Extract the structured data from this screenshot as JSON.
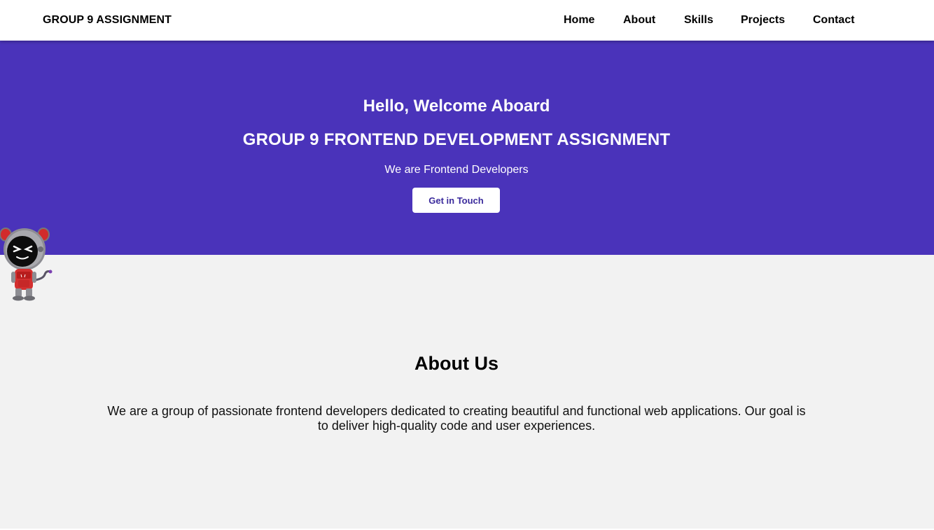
{
  "navbar": {
    "brand": "GROUP 9 ASSIGNMENT",
    "links": [
      {
        "label": "Home"
      },
      {
        "label": "About"
      },
      {
        "label": "Skills"
      },
      {
        "label": "Projects"
      },
      {
        "label": "Contact"
      }
    ]
  },
  "hero": {
    "greeting": "Hello, Welcome Aboard",
    "title": "GROUP 9 FRONTEND DEVELOPMENT ASSIGNMENT",
    "subtitle": "We are Frontend Developers",
    "cta_label": "Get in Touch",
    "background_color": "#4a33ba"
  },
  "mascot": {
    "icon": "robot-cat-mascot-icon"
  },
  "about": {
    "title": "About Us",
    "text": "We are a group of passionate frontend developers dedicated to creating beautiful and functional web applications. Our goal is to deliver high-quality code and user experiences."
  }
}
